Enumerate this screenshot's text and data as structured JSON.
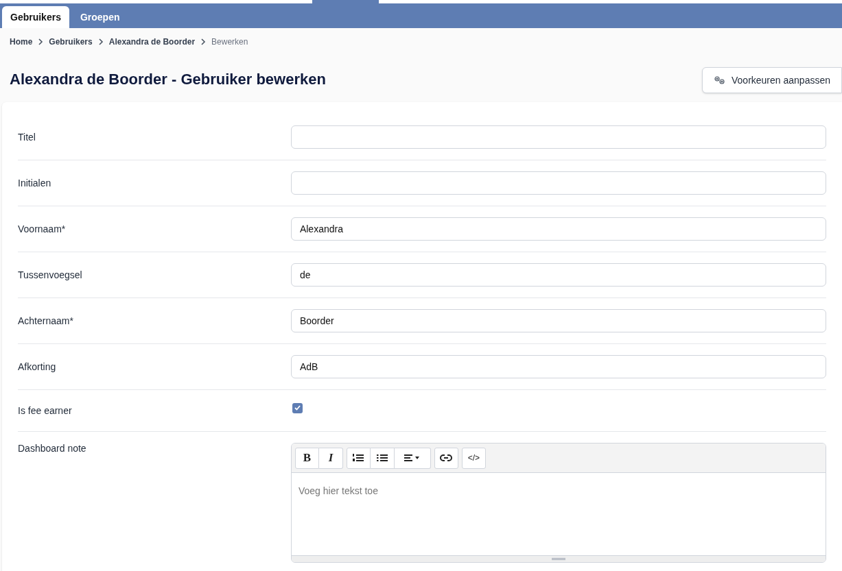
{
  "tabs": [
    {
      "label": "Gebruikers",
      "selected": true
    },
    {
      "label": "Groepen",
      "selected": false
    }
  ],
  "breadcrumb": [
    {
      "label": "Home",
      "current": false
    },
    {
      "label": "Gebruikers",
      "current": false
    },
    {
      "label": "Alexandra de Boorder",
      "current": false
    },
    {
      "label": "Bewerken",
      "current": true
    }
  ],
  "page_title": "Alexandra de Boorder - Gebruiker bewerken",
  "preferences_button": "Voorkeuren aanpassen",
  "fields": [
    {
      "kind": "text",
      "label": "Titel"
    },
    {
      "kind": "text",
      "label": "Initialen"
    },
    {
      "kind": "text",
      "label": "Voornaam*",
      "value": "Alexandra"
    },
    {
      "kind": "text",
      "label": "Tussenvoegsel",
      "value": "de"
    },
    {
      "kind": "text",
      "label": "Achternaam*",
      "value": "Boorder"
    },
    {
      "kind": "text",
      "label": "Afkorting",
      "value": "AdB"
    },
    {
      "kind": "checkbox",
      "label": "Is fee earner",
      "checked": true
    },
    {
      "kind": "editor",
      "label": "Dashboard note",
      "placeholder": "Voeg hier tekst toe",
      "toolbar": [
        [
          {
            "kind": "bold",
            "label": "B"
          },
          {
            "kind": "italic",
            "label": "I"
          }
        ],
        [
          {
            "kind": "ordered-list"
          },
          {
            "kind": "bullet-list"
          },
          {
            "kind": "align"
          }
        ],
        [
          {
            "kind": "link"
          }
        ],
        [
          {
            "kind": "code",
            "label": "</>"
          }
        ]
      ]
    }
  ]
}
